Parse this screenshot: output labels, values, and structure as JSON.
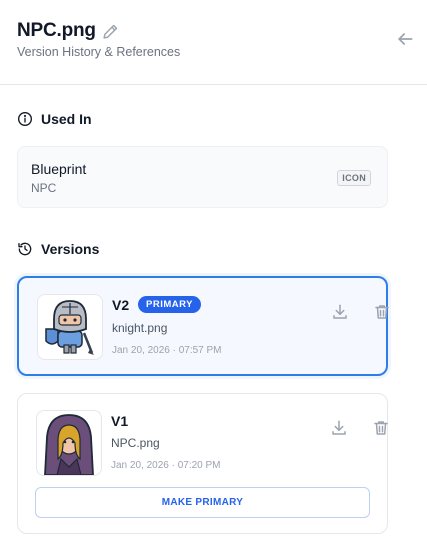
{
  "header": {
    "title": "NPC.png",
    "subtitle": "Version History & References"
  },
  "used_in": {
    "heading": "Used In",
    "items": [
      {
        "name": "Blueprint",
        "sub": "NPC",
        "badge": "ICON"
      }
    ]
  },
  "versions": {
    "heading": "Versions",
    "items": [
      {
        "label": "V2",
        "badge": "PRIMARY",
        "file": "knight.png",
        "date": "Jan 20, 2026 · 07:57 PM",
        "thumb": "knight"
      },
      {
        "label": "V1",
        "file": "NPC.png",
        "date": "Jan 20, 2026 · 07:20 PM",
        "thumb": "hooded-figure",
        "action": "MAKE PRIMARY"
      }
    ]
  },
  "colors": {
    "accent": "#2563eb",
    "selected_border": "#2f7ee8",
    "muted": "#6b7280"
  },
  "icons": {
    "edit": "pencil-icon",
    "back": "arrow-left-icon",
    "info": "info-icon",
    "history": "history-icon",
    "download": "download-icon",
    "delete": "trash-icon"
  }
}
